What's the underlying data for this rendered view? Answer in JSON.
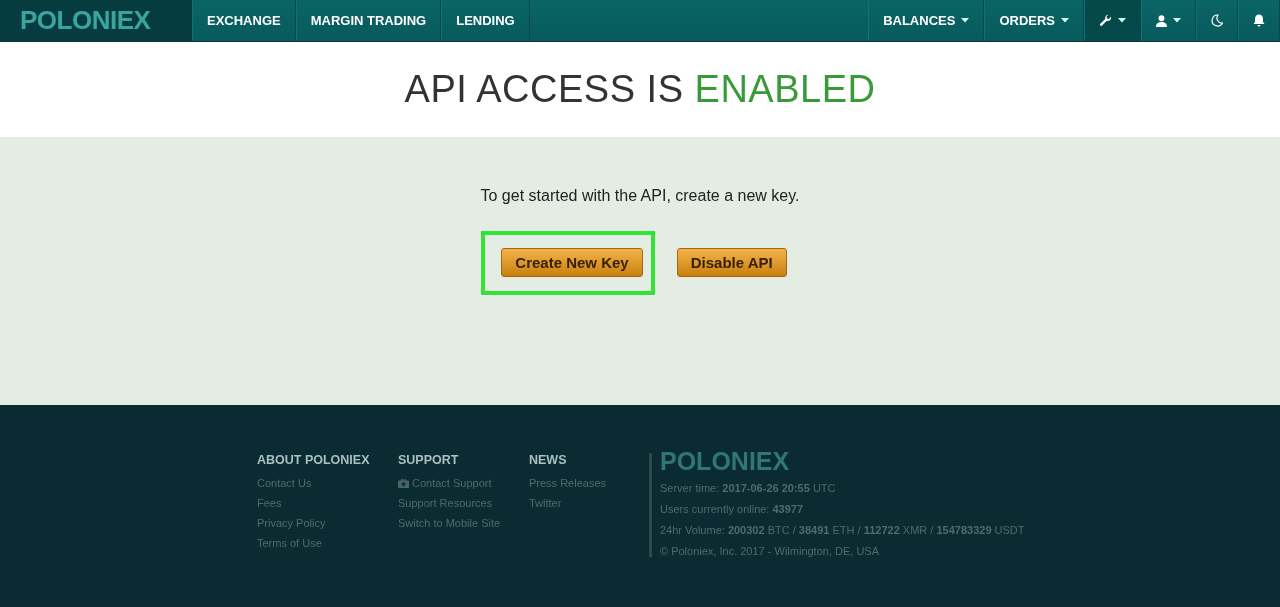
{
  "logo": "POLONIEX",
  "nav_left": [
    {
      "label": "EXCHANGE"
    },
    {
      "label": "MARGIN TRADING"
    },
    {
      "label": "LENDING"
    }
  ],
  "nav_right": [
    {
      "kind": "text",
      "label": "BALANCES",
      "dropdown": true,
      "selected": false
    },
    {
      "kind": "text",
      "label": "ORDERS",
      "dropdown": true,
      "selected": false
    },
    {
      "kind": "wrench",
      "dropdown": true,
      "selected": true
    },
    {
      "kind": "user",
      "dropdown": true,
      "selected": false
    },
    {
      "kind": "moon",
      "dropdown": false,
      "selected": false
    },
    {
      "kind": "bell",
      "dropdown": false,
      "selected": false
    }
  ],
  "heading": {
    "text": "API ACCESS IS",
    "status": "ENABLED"
  },
  "intro": "To get started with the API, create a new key.",
  "buttons": [
    {
      "label": "Create New Key",
      "highlighted": true
    },
    {
      "label": "Disable API",
      "highlighted": false
    }
  ],
  "footer": {
    "columns": [
      {
        "title": "ABOUT POLONIEX",
        "links": [
          {
            "label": "Contact Us",
            "icon": false
          },
          {
            "label": "Fees",
            "icon": false
          },
          {
            "label": "Privacy Policy",
            "icon": false
          },
          {
            "label": "Terms of Use",
            "icon": false
          }
        ]
      },
      {
        "title": "SUPPORT",
        "links": [
          {
            "label": "Contact Support",
            "icon": true
          },
          {
            "label": "Support Resources",
            "icon": false
          },
          {
            "label": "Switch to Mobile Site",
            "icon": false
          }
        ]
      },
      {
        "title": "NEWS",
        "links": [
          {
            "label": "Press Releases",
            "icon": false
          },
          {
            "label": "Twitter",
            "icon": false
          }
        ]
      }
    ],
    "logo": "POLONIEX",
    "stats": [
      "Server time: **2017-06-26 20:55** UTC",
      "Users currently online: **43977**",
      "24hr Volume: **200302** BTC / **38491** ETH / **112722** XMR / **154783329** USDT"
    ],
    "copyright": "© Poloniex, Inc. 2017 - Wilmington, DE, USA"
  }
}
